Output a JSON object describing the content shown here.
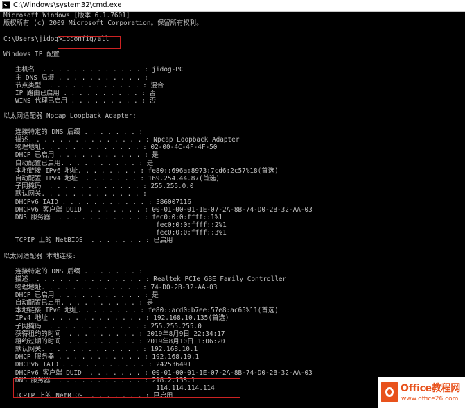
{
  "window": {
    "title": "C:\\Windows\\system32\\cmd.exe"
  },
  "console": {
    "lines": [
      "Microsoft Windows [版本 6.1.7601]",
      "版权所有 (c) 2009 Microsoft Corporation。保留所有权利。",
      "",
      "C:\\Users\\jidog>ipconfig/all",
      "",
      "Windows IP 配置",
      "",
      "   主机名  . . . . . . . . . . . . . : jidog-PC",
      "   主 DNS 后缀 . . . . . . . . . . . :",
      "   节点类型  . . . . . . . . . . . . : 混合",
      "   IP 路由已启用 . . . . . . . . . . : 否",
      "   WINS 代理已启用 . . . . . . . . . : 否",
      "",
      "以太网适配器 Npcap Loopback Adapter:",
      "",
      "   连接特定的 DNS 后缀 . . . . . . . :",
      "   描述. . . . . . . . . . . . . . . : Npcap Loopback Adapter",
      "   物理地址. . . . . . . . . . . . . : 02-00-4C-4F-4F-50",
      "   DHCP 已启用 . . . . . . . . . . . : 是",
      "   自动配置已启用. . . . . . . . . . : 是",
      "   本地链接 IPv6 地址. . . . . . . . : fe80::696a:8973:7cd6:2c57%18(首选)",
      "   自动配置 IPv4 地址  . . . . . . . : 169.254.44.87(首选)",
      "   子网掩码  . . . . . . . . . . . . : 255.255.0.0",
      "   默认网关. . . . . . . . . . . . . :",
      "   DHCPv6 IAID . . . . . . . . . . . : 386007116",
      "   DHCPv6 客户端 DUID  . . . . . . . : 00-01-00-01-1E-07-2A-8B-74-D0-2B-32-AA-03",
      "   DNS 服务器  . . . . . . . . . . . : fec0:0:0:ffff::1%1",
      "                                       fec0:0:0:ffff::2%1",
      "                                       fec0:0:0:ffff::3%1",
      "   TCPIP 上的 NetBIOS  . . . . . . . : 已启用",
      "",
      "以太网适配器 本地连接:",
      "",
      "   连接特定的 DNS 后缀 . . . . . . . :",
      "   描述. . . . . . . . . . . . . . . : Realtek PCIe GBE Family Controller",
      "   物理地址. . . . . . . . . . . . . : 74-D0-2B-32-AA-03",
      "   DHCP 已启用 . . . . . . . . . . . : 是",
      "   自动配置已启用. . . . . . . . . . : 是",
      "   本地链接 IPv6 地址. . . . . . . . : fe80::acd0:b7ee:57e8:ac65%11(首选)",
      "   IPv4 地址 . . . . . . . . . . . . : 192.168.10.135(首选)",
      "   子网掩码  . . . . . . . . . . . . : 255.255.255.0",
      "   获得租约的时间  . . . . . . . . . : 2019年8月9日 22:34:17",
      "   租约过期的时间  . . . . . . . . . : 2019年8月10日 1:06:20",
      "   默认网关. . . . . . . . . . . . . : 192.168.10.1",
      "   DHCP 服务器 . . . . . . . . . . . : 192.168.10.1",
      "   DHCPv6 IAID . . . . . . . . . . . : 242536491",
      "   DHCPv6 客户端 DUID  . . . . . . . : 00-01-00-01-1E-07-2A-8B-74-D0-2B-32-AA-03",
      "   DNS 服务器  . . . . . . . . . . . : 218.2.135.1",
      "                                       114.114.114.114",
      "   TCPIP 上的 NetBIOS  . . . . . . . : 已启用"
    ]
  },
  "watermark": {
    "name": "Office教程网",
    "url": "www.office26.com"
  },
  "colors": {
    "console_bg": "#000000",
    "console_text": "#c0c0c0",
    "highlight_border": "#cc2222",
    "brand_accent": "#e8521c"
  }
}
